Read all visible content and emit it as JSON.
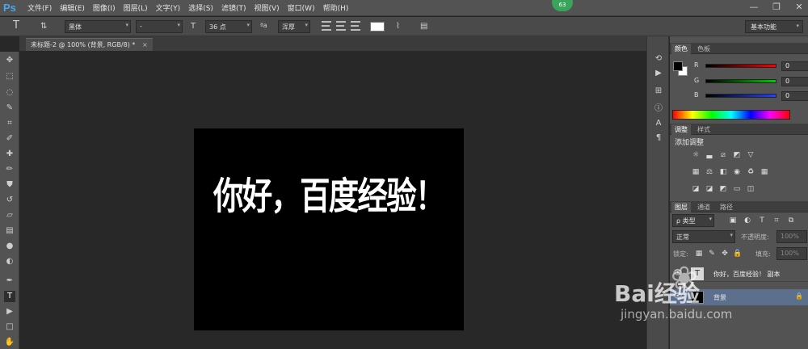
{
  "app": {
    "logo": "Ps",
    "notify_count": "63"
  },
  "menu": [
    "文件(F)",
    "编辑(E)",
    "图像(I)",
    "图层(L)",
    "文字(Y)",
    "选择(S)",
    "滤镜(T)",
    "视图(V)",
    "窗口(W)",
    "帮助(H)"
  ],
  "window_controls": {
    "minimize": "—",
    "restore": "❐",
    "close": "✕"
  },
  "options": {
    "font_family": "黑体",
    "font_style": "-",
    "font_size": "36 点",
    "aa_label": "ªa",
    "aa_mode": "浑厚",
    "text_color": "#ffffff",
    "workspace": "基本功能"
  },
  "document": {
    "tab_title": "未标题-2 @ 100% (背景, RGB/8) *",
    "close": "×"
  },
  "canvas": {
    "text": "你好，百度经验！"
  },
  "color_panel": {
    "tabs": [
      "颜色",
      "色板"
    ],
    "rows": [
      {
        "label": "R",
        "value": "0",
        "color": "#ff2020"
      },
      {
        "label": "G",
        "value": "0",
        "color": "#20c020"
      },
      {
        "label": "B",
        "value": "0",
        "color": "#2040ff"
      }
    ]
  },
  "adjust_panel": {
    "tabs": [
      "调整",
      "样式"
    ],
    "title": "添加调整"
  },
  "layers_panel": {
    "tabs": [
      "图层",
      "通道",
      "路径"
    ],
    "filter": "ρ 类型",
    "blend": "正常",
    "opacity_label": "不透明度:",
    "opacity_value": "100%",
    "lock_label": "锁定:",
    "fill_label": "填充:",
    "fill_value": "100%",
    "layers": [
      {
        "name": "你好，百度经验！ 副本",
        "thumb": "T"
      },
      {
        "name": "背景",
        "thumb": ""
      }
    ]
  },
  "watermark": {
    "brand": "Bai经验",
    "url": "jingyan.baidu.com"
  }
}
